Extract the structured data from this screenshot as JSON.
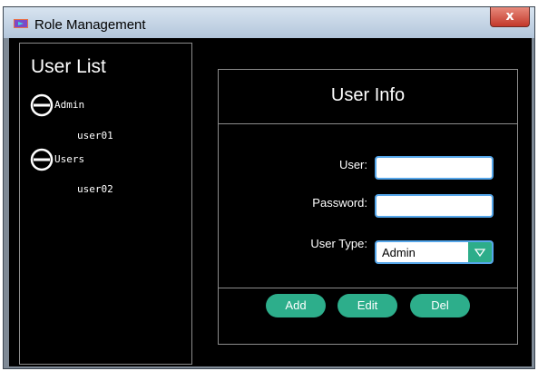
{
  "window": {
    "title": "Role Management",
    "close_label": "x"
  },
  "user_list": {
    "title": "User List",
    "groups": [
      {
        "label": "Admin",
        "users": [
          "user01"
        ]
      },
      {
        "label": "Users",
        "users": [
          "user02"
        ]
      }
    ]
  },
  "user_info": {
    "title": "User Info",
    "user_label": "User:",
    "user_value": "",
    "password_label": "Password:",
    "password_value": "",
    "user_type_label": "User Type:",
    "user_type_value": "Admin"
  },
  "buttons": {
    "add": "Add",
    "edit": "Edit",
    "del": "Del"
  },
  "colors": {
    "accent": "#2dae8b",
    "input_border": "#55a6ea",
    "background": "#000000"
  }
}
